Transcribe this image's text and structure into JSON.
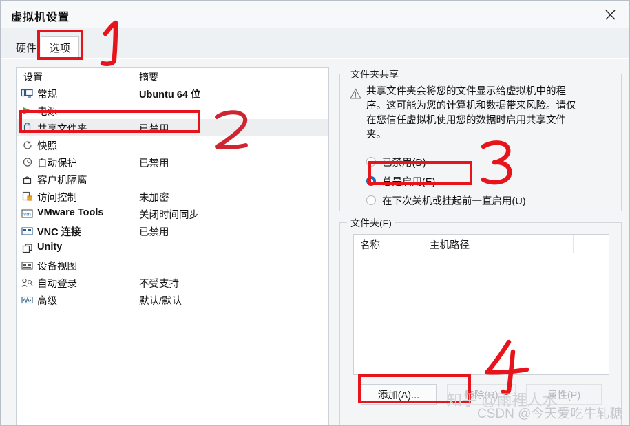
{
  "window": {
    "title": "虚拟机设置",
    "close_icon": "close-icon"
  },
  "tabs": [
    {
      "label": "硬件",
      "active": false
    },
    {
      "label": "选项",
      "active": true
    }
  ],
  "settings_list": {
    "columns": {
      "name": "设置",
      "summary": "摘要"
    },
    "rows": [
      {
        "icon": "monitor-icon",
        "label": "常规",
        "summary": "Ubuntu 64 位",
        "selected": false,
        "bold_summary": true
      },
      {
        "icon": "power-play-icon",
        "label": "电源",
        "summary": "",
        "selected": false,
        "bold_summary": false
      },
      {
        "icon": "shared-folder-icon",
        "label": "共享文件夹",
        "summary": "已禁用",
        "selected": true,
        "bold_summary": false
      },
      {
        "icon": "snapshot-icon",
        "label": "快照",
        "summary": "",
        "selected": false,
        "bold_summary": false
      },
      {
        "icon": "autoprotect-clock-icon",
        "label": "自动保护",
        "summary": "已禁用",
        "selected": false,
        "bold_summary": false
      },
      {
        "icon": "lock-icon",
        "label": "客户机隔离",
        "summary": "",
        "selected": false,
        "bold_summary": false
      },
      {
        "icon": "access-control-icon",
        "label": "访问控制",
        "summary": "未加密",
        "selected": false,
        "bold_summary": false
      },
      {
        "icon": "vmware-tools-icon",
        "label": "VMware Tools",
        "summary": "关闭时间同步",
        "selected": false,
        "bold_summary": false
      },
      {
        "icon": "vnc-icon",
        "label": "VNC 连接",
        "summary": "已禁用",
        "selected": false,
        "bold_summary": false
      },
      {
        "icon": "unity-icon",
        "label": "Unity",
        "summary": "",
        "selected": false,
        "bold_summary": false
      },
      {
        "icon": "device-view-icon",
        "label": "设备视图",
        "summary": "",
        "selected": false,
        "bold_summary": false
      },
      {
        "icon": "auto-login-icon",
        "label": "自动登录",
        "summary": "不受支持",
        "selected": false,
        "bold_summary": false
      },
      {
        "icon": "advanced-wave-icon",
        "label": "高级",
        "summary": "默认/默认",
        "selected": false,
        "bold_summary": false
      }
    ]
  },
  "sharing": {
    "group_title": "文件夹共享",
    "warning_icon": "warning-triangle-icon",
    "warning_text": "共享文件夹会将您的文件显示给虚拟机中的程序。这可能为您的计算机和数据带来风险。请仅在您信任虚拟机使用您的数据时启用共享文件夹。",
    "options": [
      {
        "label": "已禁用(D)",
        "selected": false
      },
      {
        "label": "总是启用(E)",
        "selected": true
      },
      {
        "label": "在下次关机或挂起前一直启用(U)",
        "selected": false
      }
    ]
  },
  "folders": {
    "group_title": "文件夹(F)",
    "columns": [
      "名称",
      "主机路径"
    ],
    "rows": [],
    "buttons": [
      {
        "label": "添加(A)...",
        "enabled": true
      },
      {
        "label": "移除(R)",
        "enabled": false
      },
      {
        "label": "属性(P)",
        "enabled": false
      }
    ]
  },
  "annotations": {
    "numbers": [
      "1",
      "2",
      "3",
      "4"
    ],
    "color": "#e8141b"
  },
  "watermarks": {
    "zhihu": "知乎 @雨裡人水",
    "csdn": "CSDN @今天爱吃牛轧糖"
  }
}
